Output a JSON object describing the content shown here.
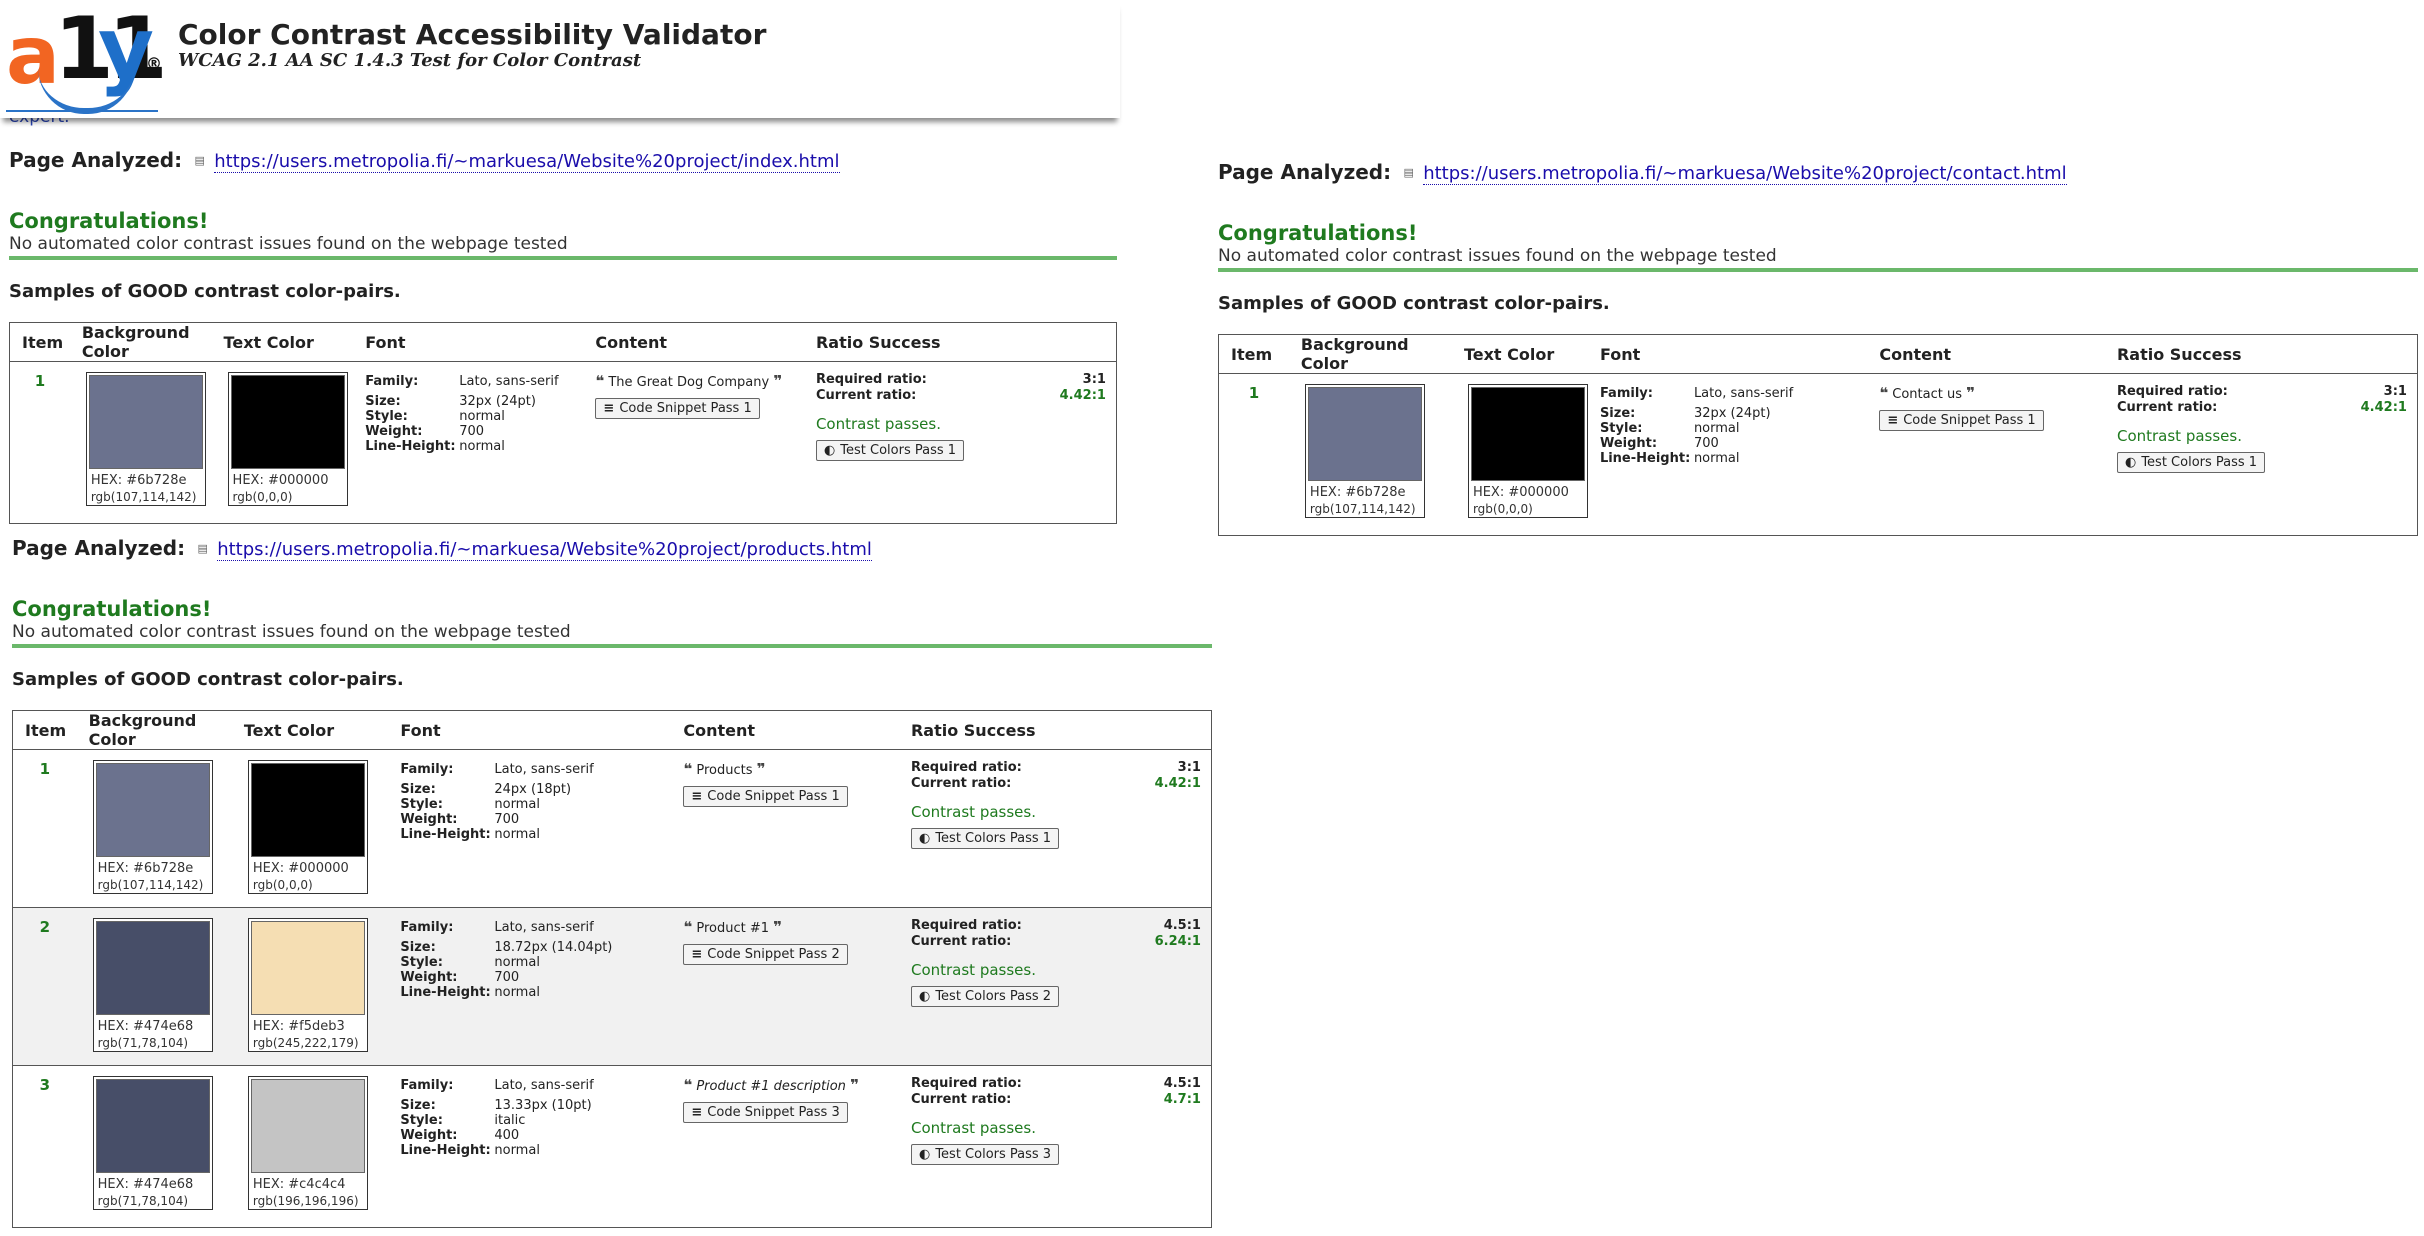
{
  "header": {
    "logo_text": "a11y",
    "title": "Color Contrast Accessibility Validator",
    "subtitle": "WCAG 2.1 AA SC 1.4.3 Test for Color Contrast",
    "expert_fragment": "expert."
  },
  "labels": {
    "page_analyzed": "Page Analyzed:",
    "congrats": "Congratulations!",
    "no_issues": "No automated color contrast issues found on the webpage tested",
    "samples": "Samples of GOOD contrast color-pairs.",
    "col_item": "Item",
    "col_bg": "Background Color",
    "col_text": "Text Color",
    "col_font": "Font",
    "col_content": "Content",
    "col_ratio": "Ratio Success",
    "family": "Family:",
    "size": "Size:",
    "style": "Style:",
    "weight": "Weight:",
    "line_height": "Line-Height:",
    "required_ratio": "Required ratio:",
    "current_ratio": "Current ratio:",
    "contrast_passes": "Contrast passes."
  },
  "panels": [
    {
      "url": "https://users.metropolia.fi/~markuesa/Website%20project/index.html",
      "rows": [
        {
          "item": "1",
          "bg_hex": "HEX: #6b728e",
          "bg_rgb": "rgb(107,114,142)",
          "bg_color": "#6b728e",
          "text_hex": "HEX: #000000",
          "text_rgb": "rgb(0,0,0)",
          "text_color": "#000000",
          "family": "Lato, sans-serif",
          "size": "32px (24pt)",
          "style": "normal",
          "weight": "700",
          "line_height": "normal",
          "content": "The Great Dog Company",
          "snippet_btn": "Code Snippet Pass 1",
          "required": "3:1",
          "current": "4.42:1",
          "test_btn": "Test Colors Pass 1"
        }
      ]
    },
    {
      "url": "https://users.metropolia.fi/~markuesa/Website%20project/contact.html",
      "rows": [
        {
          "item": "1",
          "bg_hex": "HEX: #6b728e",
          "bg_rgb": "rgb(107,114,142)",
          "bg_color": "#6b728e",
          "text_hex": "HEX: #000000",
          "text_rgb": "rgb(0,0,0)",
          "text_color": "#000000",
          "family": "Lato, sans-serif",
          "size": "32px (24pt)",
          "style": "normal",
          "weight": "700",
          "line_height": "normal",
          "content": "Contact us",
          "snippet_btn": "Code Snippet Pass 1",
          "required": "3:1",
          "current": "4.42:1",
          "test_btn": "Test Colors Pass 1"
        }
      ]
    },
    {
      "url": "https://users.metropolia.fi/~markuesa/Website%20project/products.html",
      "rows": [
        {
          "item": "1",
          "bg_hex": "HEX: #6b728e",
          "bg_rgb": "rgb(107,114,142)",
          "bg_color": "#6b728e",
          "text_hex": "HEX: #000000",
          "text_rgb": "rgb(0,0,0)",
          "text_color": "#000000",
          "family": "Lato, sans-serif",
          "size": "24px (18pt)",
          "style": "normal",
          "weight": "700",
          "line_height": "normal",
          "content": "Products",
          "snippet_btn": "Code Snippet Pass 1",
          "required": "3:1",
          "current": "4.42:1",
          "test_btn": "Test Colors Pass 1"
        },
        {
          "item": "2",
          "bg_hex": "HEX: #474e68",
          "bg_rgb": "rgb(71,78,104)",
          "bg_color": "#474e68",
          "text_hex": "HEX: #f5deb3",
          "text_rgb": "rgb(245,222,179)",
          "text_color": "#f5deb3",
          "family": "Lato, sans-serif",
          "size": "18.72px (14.04pt)",
          "style": "normal",
          "weight": "700",
          "line_height": "normal",
          "content": "Product #1",
          "snippet_btn": "Code Snippet Pass 2",
          "required": "4.5:1",
          "current": "6.24:1",
          "test_btn": "Test Colors Pass 2"
        },
        {
          "item": "3",
          "bg_hex": "HEX: #474e68",
          "bg_rgb": "rgb(71,78,104)",
          "bg_color": "#474e68",
          "text_hex": "HEX: #c4c4c4",
          "text_rgb": "rgb(196,196,196)",
          "text_color": "#c4c4c4",
          "family": "Lato, sans-serif",
          "size": "13.33px (10pt)",
          "style": "italic",
          "weight": "400",
          "line_height": "normal",
          "content": "Product #1 description",
          "snippet_btn": "Code Snippet Pass 3",
          "required": "4.5:1",
          "current": "4.7:1",
          "test_btn": "Test Colors Pass 3"
        }
      ]
    }
  ],
  "colors": {
    "accent_green": "#1f7a1f",
    "link_blue": "#1a0dab",
    "logo_orange": "#f26522",
    "logo_blue": "#1e6fc9"
  }
}
